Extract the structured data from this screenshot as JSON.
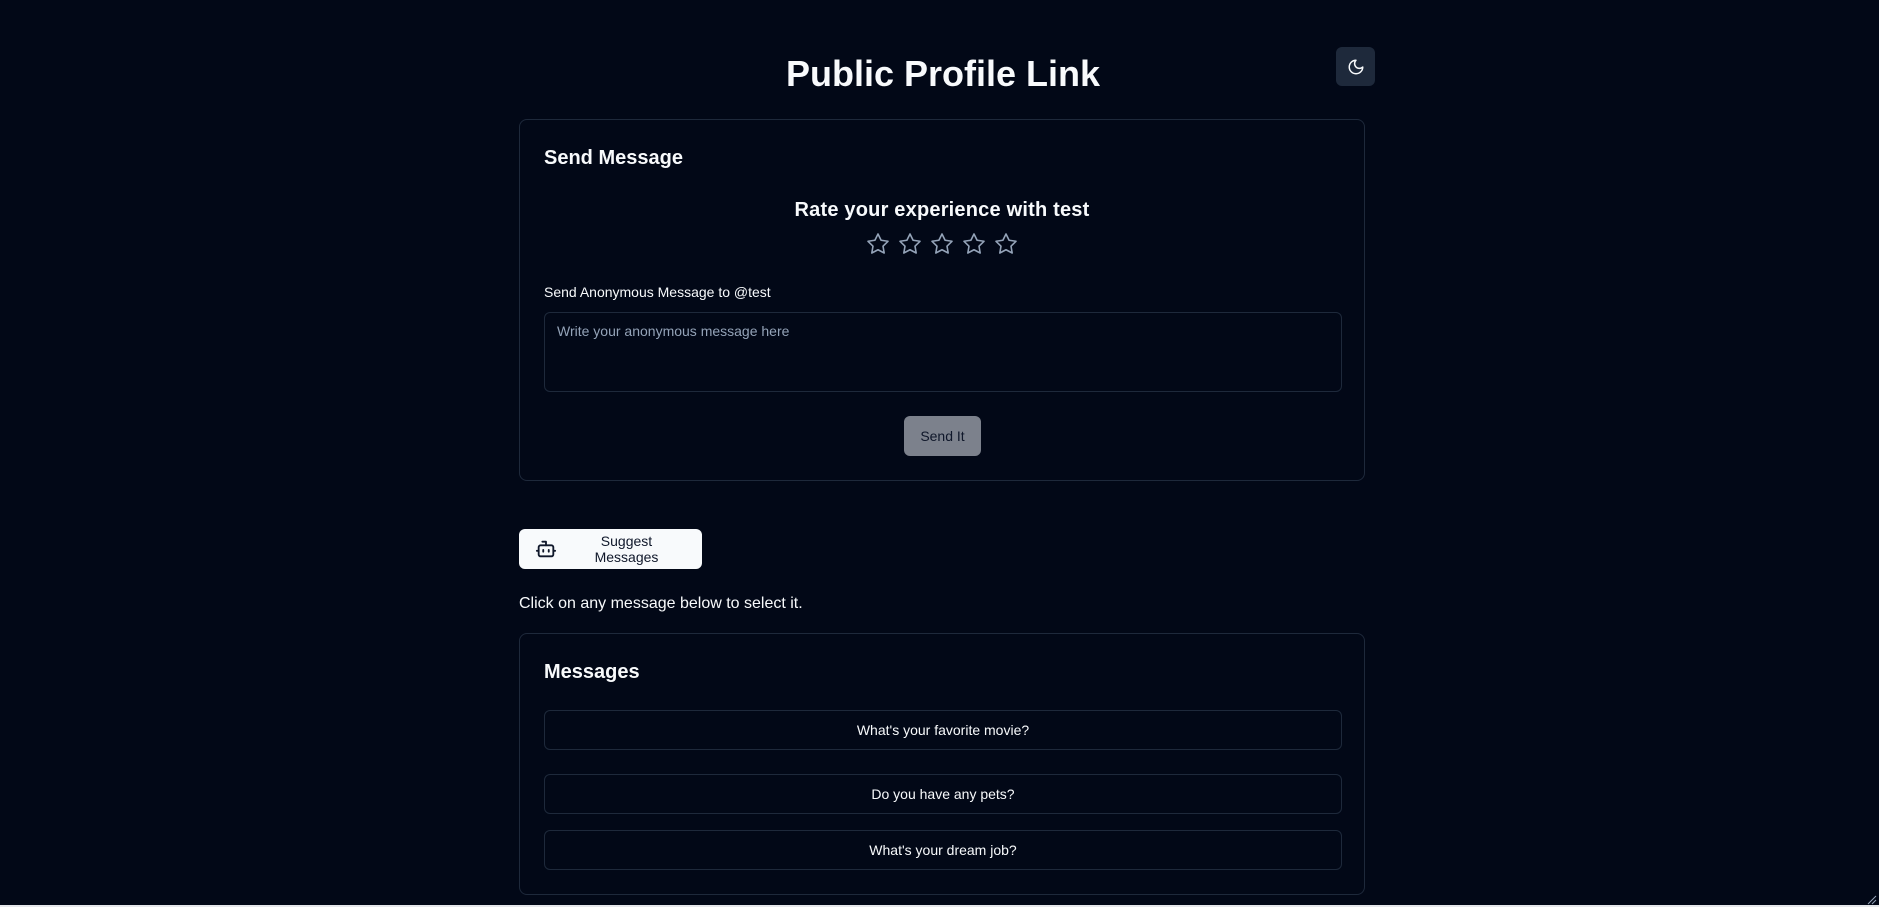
{
  "header": {
    "title": "Public Profile Link",
    "theme_toggle_icon": "moon-icon"
  },
  "send_card": {
    "title": "Send Message",
    "rating_heading": "Rate your experience with test",
    "rating": {
      "value": 0,
      "max": 5
    },
    "field_label": "Send Anonymous Message to @test",
    "input": {
      "value": "",
      "placeholder": "Write your anonymous message here"
    },
    "submit_label": "Send It"
  },
  "suggest": {
    "button_label": "Suggest Messages",
    "button_icon": "bot-icon",
    "helper_text": "Click on any message below to select it."
  },
  "messages_card": {
    "title": "Messages",
    "items": [
      {
        "text": "What's your favorite movie?"
      },
      {
        "text": "Do you have any pets?"
      },
      {
        "text": "What's your dream job?"
      }
    ]
  },
  "colors": {
    "background": "#020817",
    "border": "#1e293b",
    "foreground": "#f8fafc",
    "muted": "#94a3b8",
    "disabled_button": "#7c818c"
  }
}
